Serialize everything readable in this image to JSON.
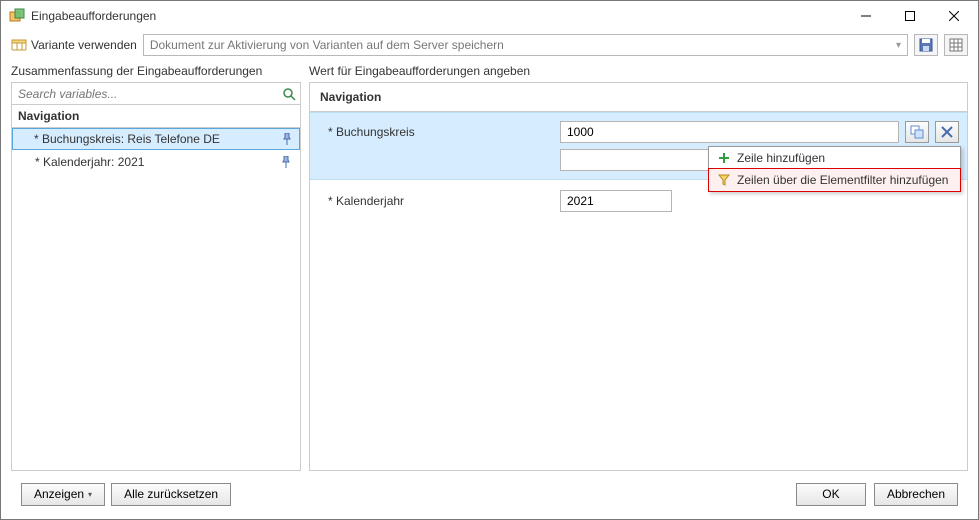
{
  "window": {
    "title": "Eingabeaufforderungen"
  },
  "toolbar": {
    "variant_label": "Variante verwenden",
    "variant_placeholder": "Dokument zur Aktivierung von Varianten auf dem Server speichern"
  },
  "left": {
    "caption": "Zusammenfassung der Eingabeaufforderungen",
    "search_placeholder": "Search variables...",
    "section": "Navigation",
    "items": [
      {
        "label": "* Buchungskreis: Reis Telefone DE",
        "selected": true
      },
      {
        "label": "* Kalenderjahr: 2021",
        "selected": false
      }
    ]
  },
  "right": {
    "caption": "Wert für Eingabeaufforderungen angeben",
    "section": "Navigation",
    "fields": [
      {
        "label": "* Buchungskreis",
        "value": "1000",
        "extra_row": true
      },
      {
        "label": "* Kalenderjahr",
        "value": "2021",
        "extra_row": false
      }
    ]
  },
  "popup": {
    "items": [
      {
        "label": "Zeile hinzufügen",
        "icon": "plus"
      },
      {
        "label": "Zeilen über die Elementfilter hinzufügen",
        "icon": "funnel",
        "highlight": true
      }
    ]
  },
  "footer": {
    "show": "Anzeigen",
    "reset": "Alle zurücksetzen",
    "ok": "OK",
    "cancel": "Abbrechen"
  }
}
